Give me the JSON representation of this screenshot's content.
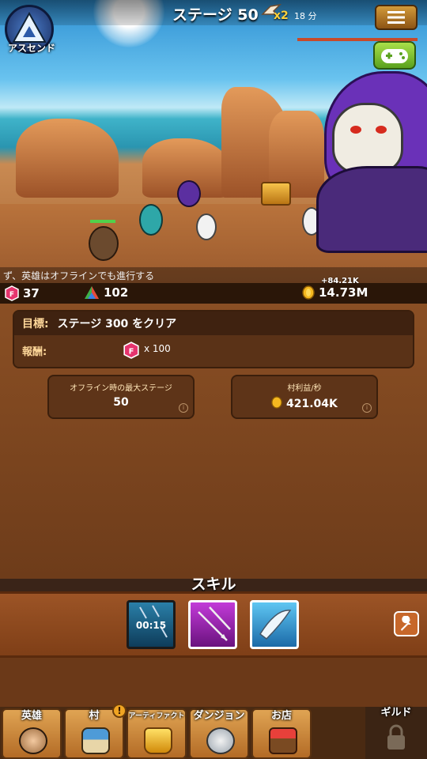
{
  "header": {
    "stage_label": "ステージ 50",
    "boost_multiplier": "x2",
    "boost_time": "18 分",
    "ascend_label": "アスセンド"
  },
  "ticker": {
    "text": "ず、英雄はオフラインでも進行する"
  },
  "currency": {
    "gems": "37",
    "crystals": "102",
    "gold": "14.73M",
    "gold_gain": "+84.21K"
  },
  "goal": {
    "goal_label": "目標:",
    "goal_text": "ステージ 300 をクリア",
    "reward_label": "報酬:",
    "reward_amount": "x 100"
  },
  "stats": {
    "offline_max_title": "オフライン時の最大ステージ",
    "offline_max_value": "50",
    "village_income_title": "村利益/秒",
    "village_income_value": "421.04K"
  },
  "skills": {
    "title": "スキル",
    "cooldown": "00:15",
    "items": [
      {
        "icon": "arrow-rain-icon"
      },
      {
        "icon": "multi-arrow-icon"
      },
      {
        "icon": "blade-slash-icon"
      }
    ]
  },
  "nav": {
    "heroes": "英雄",
    "village": "村",
    "artifacts": "アーティファクト",
    "dungeon": "ダンジョン",
    "shop": "お店",
    "guild": "ギルド",
    "alert": "!"
  },
  "colors": {
    "gold_text": "#ffd23c",
    "panel_brown": "#5e3418",
    "gem_pink": "#e6346e"
  }
}
